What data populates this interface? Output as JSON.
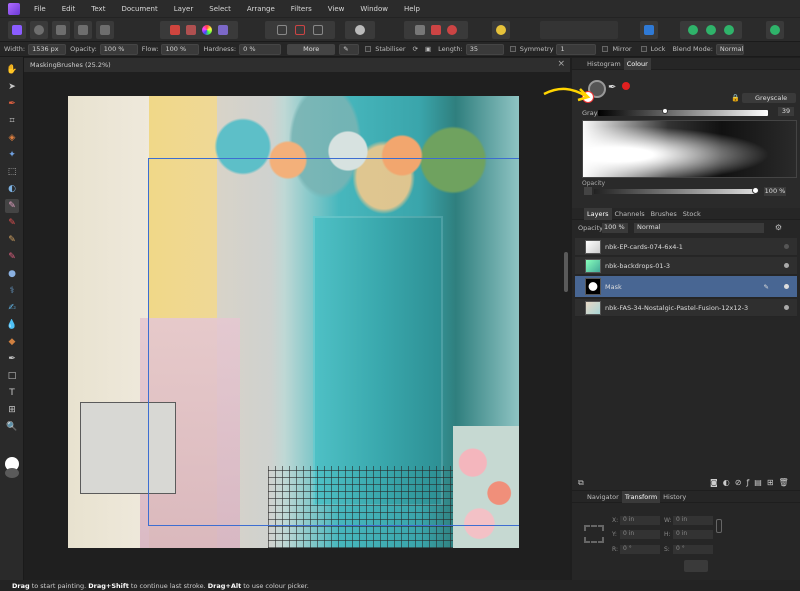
{
  "menu": [
    "File",
    "Edit",
    "Text",
    "Document",
    "Layer",
    "Select",
    "Arrange",
    "Filters",
    "View",
    "Window",
    "Help"
  ],
  "context_toolbar": {
    "width_label": "Width:",
    "width_value": "1536 px",
    "opacity_label": "Opacity:",
    "opacity_value": "100 %",
    "flow_label": "Flow:",
    "flow_value": "100 %",
    "hardness_label": "Hardness:",
    "hardness_value": "0 %",
    "more_label": "More",
    "stabiliser_label": "Stabiliser",
    "length_label": "Length:",
    "length_value": "35",
    "symmetry_label": "Symmetry",
    "symmetry_value": "1",
    "mirror_label": "Mirror",
    "lock_label": "Lock",
    "blend_label": "Blend Mode:",
    "blend_value": "Normal"
  },
  "document": {
    "tab_title": "MaskingBrushes (25.2%)"
  },
  "colour_panel": {
    "tabs": [
      "Histogram",
      "Colour"
    ],
    "mode": "Greyscale",
    "gray_label": "Gray:",
    "gray_value": "39",
    "gray_level": 0.39,
    "opacity_label": "Opacity",
    "opacity_value": "100 %"
  },
  "layers_panel": {
    "tabs": [
      "Layers",
      "Channels",
      "Brushes",
      "Stock"
    ],
    "opacity_label": "Opacity:",
    "opacity_value": "100 %",
    "blend_value": "Normal",
    "layers": [
      {
        "name": "nbk-EP-cards-074-6x4-1",
        "selected": false
      },
      {
        "name": "nbk-backdrops-01-3",
        "selected": false
      },
      {
        "name": "Mask",
        "selected": true
      },
      {
        "name": "nbk-FAS-34-Nostalgic-Pastel-Fusion-12x12-3",
        "selected": false
      }
    ]
  },
  "transform_panel": {
    "tabs": [
      "Navigator",
      "Transform",
      "History"
    ],
    "x_label": "X:",
    "x_value": "0 in",
    "y_label": "Y:",
    "y_value": "0 in",
    "w_label": "W:",
    "w_value": "0 in",
    "h_label": "H:",
    "h_value": "0 in",
    "r_label": "R:",
    "r_value": "0 °",
    "s_label": "S:",
    "s_value": "0 °"
  },
  "status": {
    "part1_bold": "Drag",
    "part1": " to start painting. ",
    "part2_bold": "Drag+Shift",
    "part2": " to continue last stroke. ",
    "part3_bold": "Drag+Alt",
    "part3": " to use colour picker."
  },
  "colors": {
    "accent": "#486693",
    "selection": "#3d6ed1",
    "annotation_arrow": "#ffd400",
    "brush_red": "#e02020"
  }
}
